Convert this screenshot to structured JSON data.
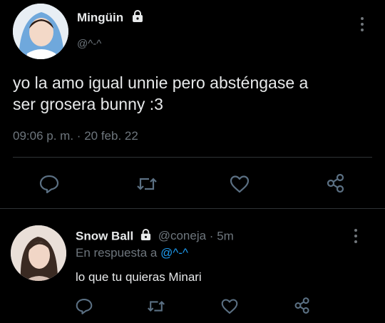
{
  "main_tweet": {
    "author_name": "Mingüin",
    "handle": "@^-^",
    "text_line1": "yo la amo igual unnie pero absténgase a",
    "text_line2": "ser grosera bunny :3",
    "time": "09:06 p. m.",
    "date_sep": "·",
    "date": "20 feb. 22"
  },
  "reply": {
    "author_name": "Snow Ball",
    "handle": "@coneja",
    "time_sep": "·",
    "time": "5m",
    "replying_prefix": "En respuesta a",
    "replying_handle": "@^-^",
    "text": "lo que tu quieras Minari"
  },
  "colors": {
    "background": "#000000",
    "text": "#e7e9ea",
    "muted": "#6e767d",
    "link": "#1d9bf0",
    "icon": "#5b7083"
  },
  "icons": [
    "lock-icon",
    "more-icon",
    "reply-icon",
    "retweet-icon",
    "like-icon",
    "share-icon"
  ]
}
